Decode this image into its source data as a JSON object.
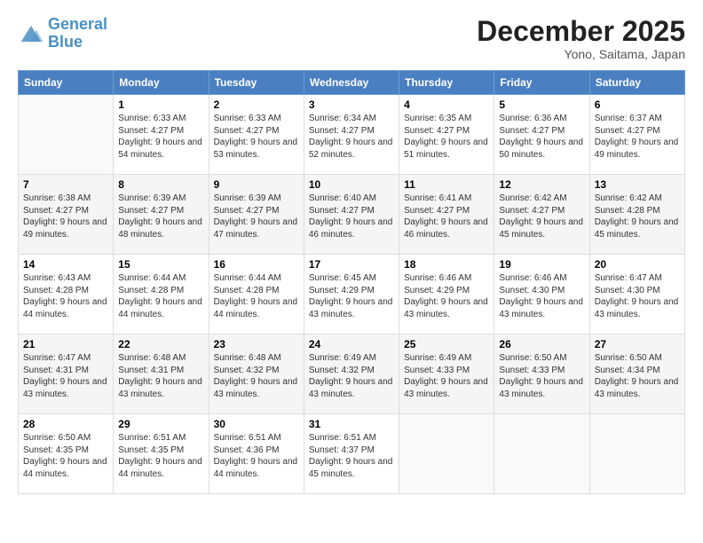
{
  "header": {
    "logo_line1": "General",
    "logo_line2": "Blue",
    "month": "December 2025",
    "location": "Yono, Saitama, Japan"
  },
  "weekdays": [
    "Sunday",
    "Monday",
    "Tuesday",
    "Wednesday",
    "Thursday",
    "Friday",
    "Saturday"
  ],
  "weeks": [
    [
      {
        "day": "",
        "sunrise": "",
        "sunset": "",
        "daylight": ""
      },
      {
        "day": "1",
        "sunrise": "Sunrise: 6:33 AM",
        "sunset": "Sunset: 4:27 PM",
        "daylight": "Daylight: 9 hours and 54 minutes."
      },
      {
        "day": "2",
        "sunrise": "Sunrise: 6:33 AM",
        "sunset": "Sunset: 4:27 PM",
        "daylight": "Daylight: 9 hours and 53 minutes."
      },
      {
        "day": "3",
        "sunrise": "Sunrise: 6:34 AM",
        "sunset": "Sunset: 4:27 PM",
        "daylight": "Daylight: 9 hours and 52 minutes."
      },
      {
        "day": "4",
        "sunrise": "Sunrise: 6:35 AM",
        "sunset": "Sunset: 4:27 PM",
        "daylight": "Daylight: 9 hours and 51 minutes."
      },
      {
        "day": "5",
        "sunrise": "Sunrise: 6:36 AM",
        "sunset": "Sunset: 4:27 PM",
        "daylight": "Daylight: 9 hours and 50 minutes."
      },
      {
        "day": "6",
        "sunrise": "Sunrise: 6:37 AM",
        "sunset": "Sunset: 4:27 PM",
        "daylight": "Daylight: 9 hours and 49 minutes."
      }
    ],
    [
      {
        "day": "7",
        "sunrise": "Sunrise: 6:38 AM",
        "sunset": "Sunset: 4:27 PM",
        "daylight": "Daylight: 9 hours and 49 minutes."
      },
      {
        "day": "8",
        "sunrise": "Sunrise: 6:39 AM",
        "sunset": "Sunset: 4:27 PM",
        "daylight": "Daylight: 9 hours and 48 minutes."
      },
      {
        "day": "9",
        "sunrise": "Sunrise: 6:39 AM",
        "sunset": "Sunset: 4:27 PM",
        "daylight": "Daylight: 9 hours and 47 minutes."
      },
      {
        "day": "10",
        "sunrise": "Sunrise: 6:40 AM",
        "sunset": "Sunset: 4:27 PM",
        "daylight": "Daylight: 9 hours and 46 minutes."
      },
      {
        "day": "11",
        "sunrise": "Sunrise: 6:41 AM",
        "sunset": "Sunset: 4:27 PM",
        "daylight": "Daylight: 9 hours and 46 minutes."
      },
      {
        "day": "12",
        "sunrise": "Sunrise: 6:42 AM",
        "sunset": "Sunset: 4:27 PM",
        "daylight": "Daylight: 9 hours and 45 minutes."
      },
      {
        "day": "13",
        "sunrise": "Sunrise: 6:42 AM",
        "sunset": "Sunset: 4:28 PM",
        "daylight": "Daylight: 9 hours and 45 minutes."
      }
    ],
    [
      {
        "day": "14",
        "sunrise": "Sunrise: 6:43 AM",
        "sunset": "Sunset: 4:28 PM",
        "daylight": "Daylight: 9 hours and 44 minutes."
      },
      {
        "day": "15",
        "sunrise": "Sunrise: 6:44 AM",
        "sunset": "Sunset: 4:28 PM",
        "daylight": "Daylight: 9 hours and 44 minutes."
      },
      {
        "day": "16",
        "sunrise": "Sunrise: 6:44 AM",
        "sunset": "Sunset: 4:28 PM",
        "daylight": "Daylight: 9 hours and 44 minutes."
      },
      {
        "day": "17",
        "sunrise": "Sunrise: 6:45 AM",
        "sunset": "Sunset: 4:29 PM",
        "daylight": "Daylight: 9 hours and 43 minutes."
      },
      {
        "day": "18",
        "sunrise": "Sunrise: 6:46 AM",
        "sunset": "Sunset: 4:29 PM",
        "daylight": "Daylight: 9 hours and 43 minutes."
      },
      {
        "day": "19",
        "sunrise": "Sunrise: 6:46 AM",
        "sunset": "Sunset: 4:30 PM",
        "daylight": "Daylight: 9 hours and 43 minutes."
      },
      {
        "day": "20",
        "sunrise": "Sunrise: 6:47 AM",
        "sunset": "Sunset: 4:30 PM",
        "daylight": "Daylight: 9 hours and 43 minutes."
      }
    ],
    [
      {
        "day": "21",
        "sunrise": "Sunrise: 6:47 AM",
        "sunset": "Sunset: 4:31 PM",
        "daylight": "Daylight: 9 hours and 43 minutes."
      },
      {
        "day": "22",
        "sunrise": "Sunrise: 6:48 AM",
        "sunset": "Sunset: 4:31 PM",
        "daylight": "Daylight: 9 hours and 43 minutes."
      },
      {
        "day": "23",
        "sunrise": "Sunrise: 6:48 AM",
        "sunset": "Sunset: 4:32 PM",
        "daylight": "Daylight: 9 hours and 43 minutes."
      },
      {
        "day": "24",
        "sunrise": "Sunrise: 6:49 AM",
        "sunset": "Sunset: 4:32 PM",
        "daylight": "Daylight: 9 hours and 43 minutes."
      },
      {
        "day": "25",
        "sunrise": "Sunrise: 6:49 AM",
        "sunset": "Sunset: 4:33 PM",
        "daylight": "Daylight: 9 hours and 43 minutes."
      },
      {
        "day": "26",
        "sunrise": "Sunrise: 6:50 AM",
        "sunset": "Sunset: 4:33 PM",
        "daylight": "Daylight: 9 hours and 43 minutes."
      },
      {
        "day": "27",
        "sunrise": "Sunrise: 6:50 AM",
        "sunset": "Sunset: 4:34 PM",
        "daylight": "Daylight: 9 hours and 43 minutes."
      }
    ],
    [
      {
        "day": "28",
        "sunrise": "Sunrise: 6:50 AM",
        "sunset": "Sunset: 4:35 PM",
        "daylight": "Daylight: 9 hours and 44 minutes."
      },
      {
        "day": "29",
        "sunrise": "Sunrise: 6:51 AM",
        "sunset": "Sunset: 4:35 PM",
        "daylight": "Daylight: 9 hours and 44 minutes."
      },
      {
        "day": "30",
        "sunrise": "Sunrise: 6:51 AM",
        "sunset": "Sunset: 4:36 PM",
        "daylight": "Daylight: 9 hours and 44 minutes."
      },
      {
        "day": "31",
        "sunrise": "Sunrise: 6:51 AM",
        "sunset": "Sunset: 4:37 PM",
        "daylight": "Daylight: 9 hours and 45 minutes."
      },
      {
        "day": "",
        "sunrise": "",
        "sunset": "",
        "daylight": ""
      },
      {
        "day": "",
        "sunrise": "",
        "sunset": "",
        "daylight": ""
      },
      {
        "day": "",
        "sunrise": "",
        "sunset": "",
        "daylight": ""
      }
    ]
  ]
}
